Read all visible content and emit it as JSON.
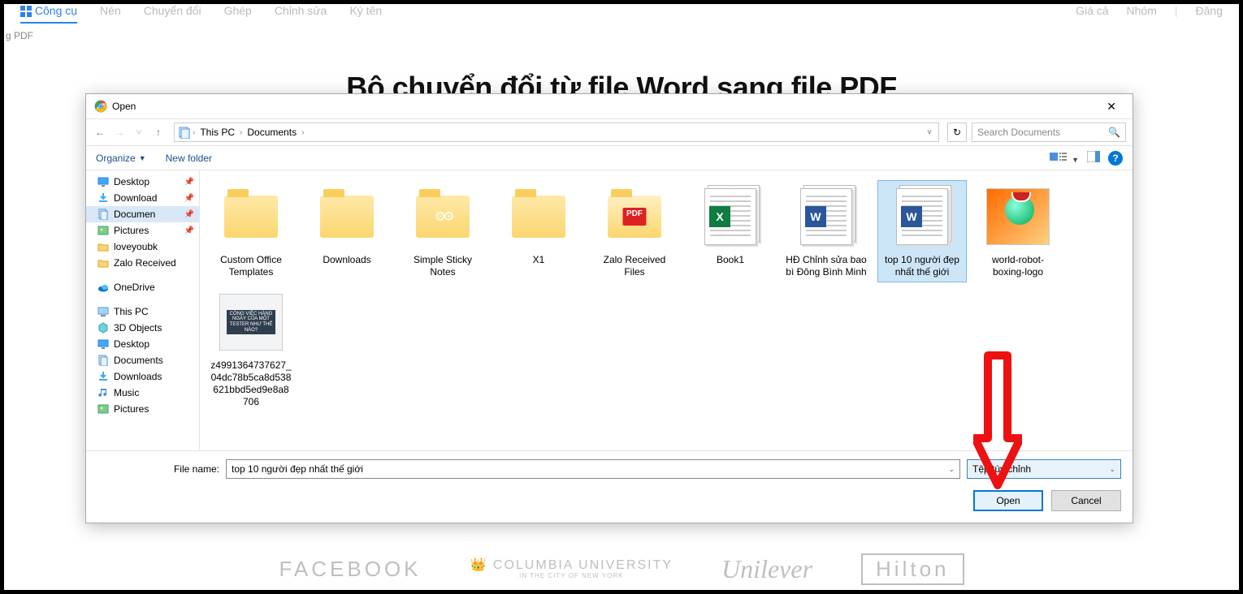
{
  "topnav": {
    "items": [
      "Công cụ",
      "Nén",
      "Chuyển đổi",
      "Ghép",
      "Chỉnh sửa",
      "Ký tên"
    ],
    "right": [
      "Giá cả",
      "Nhóm"
    ],
    "login": "Đăng"
  },
  "subline": "g PDF",
  "headline": "Bộ chuyển đổi từ file Word sang file PDF",
  "dialog": {
    "title": "Open",
    "breadcrumb": [
      "This PC",
      "Documents"
    ],
    "search_placeholder": "Search Documents",
    "organize": "Organize",
    "newfolder": "New folder",
    "sidebar_quick": [
      {
        "label": "Desktop",
        "icon": "desktop",
        "pin": true
      },
      {
        "label": "Download",
        "icon": "download",
        "pin": true
      },
      {
        "label": "Documen",
        "icon": "documents",
        "pin": true,
        "selected": true
      },
      {
        "label": "Pictures",
        "icon": "pictures",
        "pin": true
      },
      {
        "label": "loveyoubk",
        "icon": "folder"
      },
      {
        "label": "Zalo Received",
        "icon": "folder"
      }
    ],
    "sidebar_onedrive": {
      "label": "OneDrive",
      "icon": "onedrive"
    },
    "sidebar_thispc": {
      "label": "This PC",
      "icon": "thispc"
    },
    "sidebar_pc_children": [
      {
        "label": "3D Objects",
        "icon": "3d"
      },
      {
        "label": "Desktop",
        "icon": "desktop"
      },
      {
        "label": "Documents",
        "icon": "documents"
      },
      {
        "label": "Downloads",
        "icon": "download"
      },
      {
        "label": "Music",
        "icon": "music"
      },
      {
        "label": "Pictures",
        "icon": "pictures"
      }
    ],
    "files": [
      {
        "label": "Custom Office Templates",
        "type": "folder"
      },
      {
        "label": "Downloads",
        "type": "folder"
      },
      {
        "label": "Simple Sticky Notes",
        "type": "folder-gear"
      },
      {
        "label": "X1",
        "type": "folder"
      },
      {
        "label": "Zalo Received Files",
        "type": "folder-pdf"
      },
      {
        "label": "Book1",
        "type": "xlsx"
      },
      {
        "label": "HĐ Chỉnh sửa bao bì Đông Bình Minh",
        "type": "docx"
      },
      {
        "label": "top 10 người đẹp nhất thế giới",
        "type": "docx",
        "selected": true
      },
      {
        "label": "world-robot-boxing-logo",
        "type": "img-robot"
      },
      {
        "label": "z4991364737627_04dc78b5ca8d538621bbd5ed9e8a8706",
        "type": "img-tester",
        "tester_text": "CÔNG VIỆC HÀNG NGÀY CỦA MỘT TESTER NHƯ THẾ NÀO?"
      }
    ],
    "filename_label": "File name:",
    "filename_value": "top 10 người đẹp nhất thế giới",
    "filetype": "Tệp tùy chỉnh",
    "open": "Open",
    "cancel": "Cancel"
  },
  "brands": {
    "facebook": "FACEBOOK",
    "columbia": "COLUMBIA UNIVERSITY",
    "columbia_sub": "IN THE CITY OF NEW YORK",
    "unilever": "Unilever",
    "hilton": "Hilton"
  }
}
